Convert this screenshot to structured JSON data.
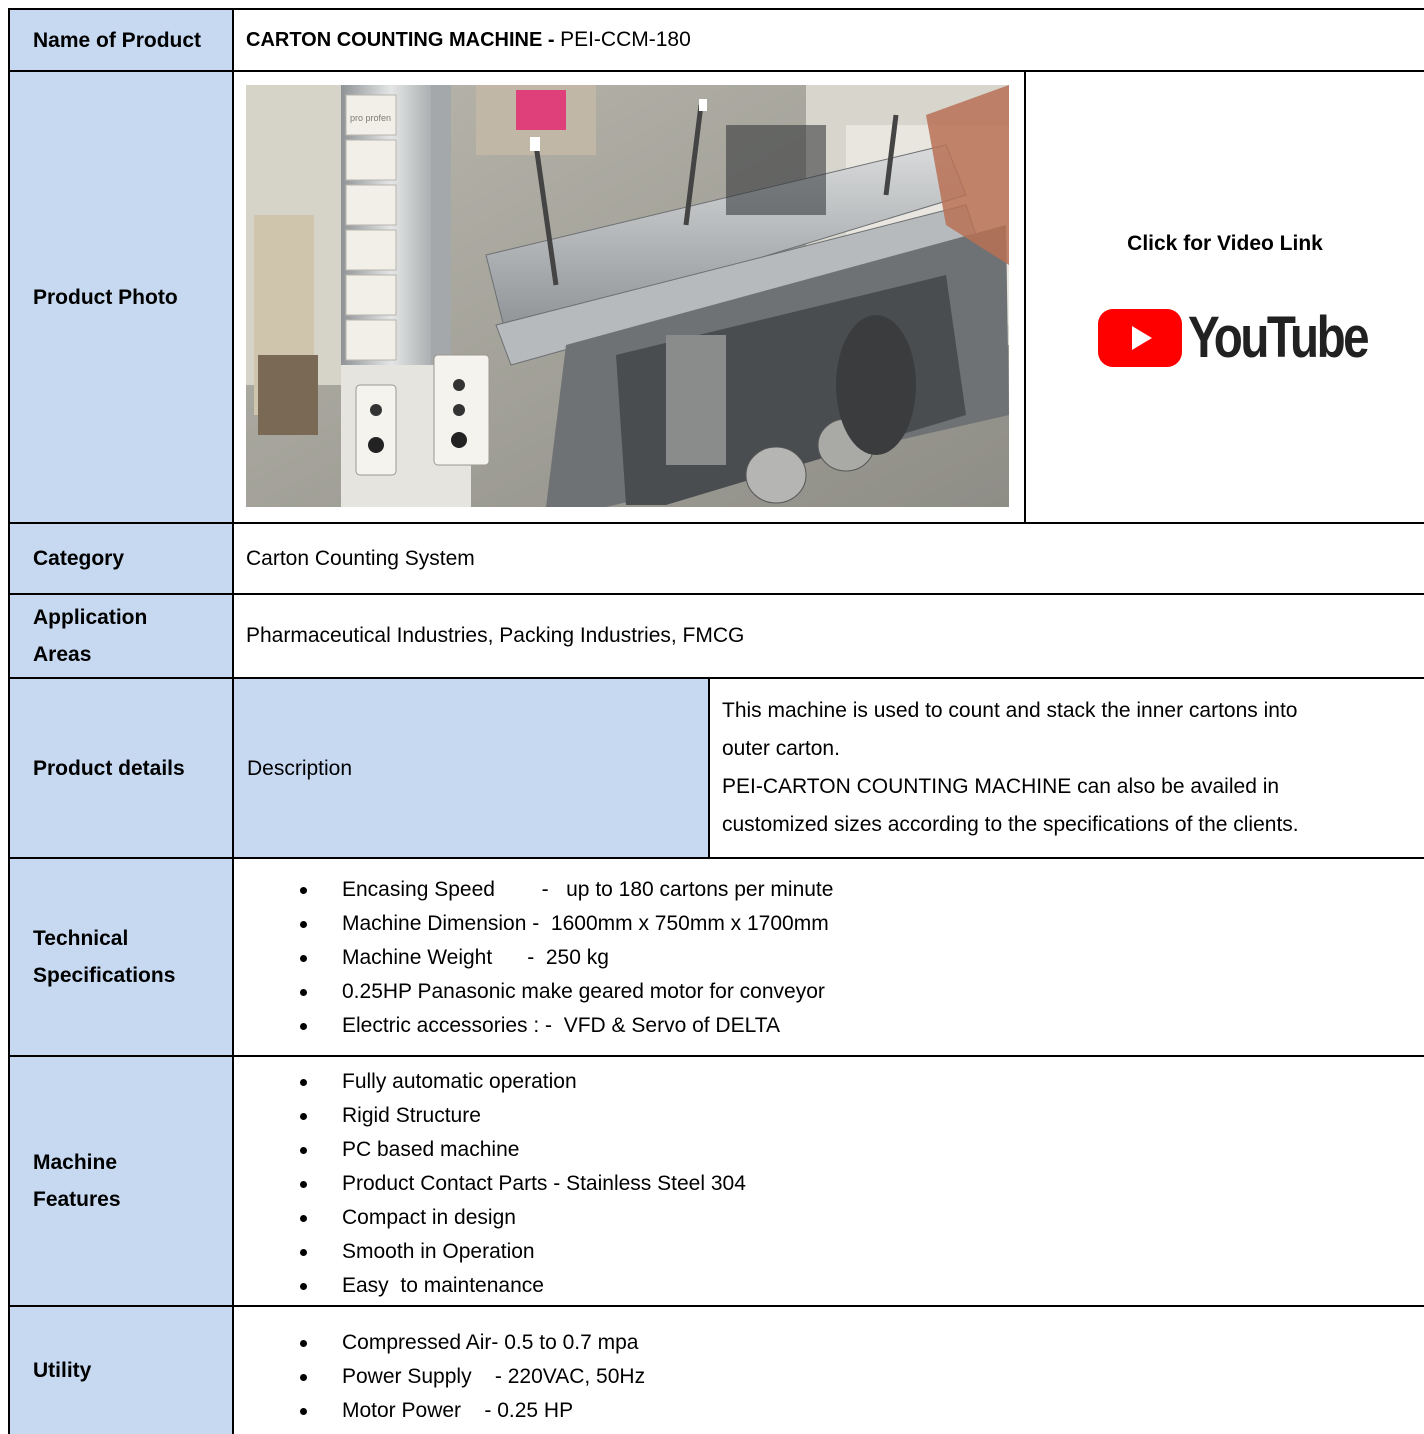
{
  "product_name": {
    "label": "Name of Product",
    "name_bold": "CARTON COUNTING MACHINE - ",
    "model": "PEI-CCM-180"
  },
  "photo": {
    "label": "Product Photo",
    "carton_text": "pro profen",
    "video_link_text": "Click for Video Link",
    "youtube_wordmark": "YouTube",
    "youtube_color": "#ff0000"
  },
  "category": {
    "label": "Category",
    "value": "Carton Counting System"
  },
  "application": {
    "label_line1": "Application",
    "label_line2": "Areas",
    "value": "Pharmaceutical Industries, Packing Industries, FMCG"
  },
  "product_details": {
    "label": "Product details",
    "sub_label": "Description",
    "lines": [
      "This machine is used to count and stack the inner cartons into",
      "outer carton.",
      "PEI-CARTON COUNTING MACHINE can also be availed in",
      "customized sizes according to the specifications of the clients."
    ]
  },
  "technical": {
    "label_line1": "Technical",
    "label_line2": "Specifications",
    "items": [
      "Encasing Speed        -   up to 180 cartons per minute",
      "Machine Dimension -  1600mm x 750mm x 1700mm",
      "Machine Weight      -  250 kg",
      "0.25HP Panasonic make geared motor for conveyor",
      "Electric accessories : -  VFD & Servo of DELTA"
    ]
  },
  "features": {
    "label_line1": "Machine",
    "label_line2": "Features",
    "items": [
      "Fully automatic operation",
      "Rigid Structure",
      "PC based machine",
      "Product Contact Parts - Stainless Steel 304",
      "Compact in design",
      "Smooth in Operation",
      "Easy  to maintenance"
    ]
  },
  "utility": {
    "label": "Utility",
    "items": [
      "Compressed Air- 0.5 to 0.7 mpa",
      "Power Supply    - 220VAC, 50Hz",
      "Motor Power    - 0.25 HP"
    ]
  },
  "colors": {
    "label_bg": "#c6d9f1",
    "border": "#000000"
  }
}
